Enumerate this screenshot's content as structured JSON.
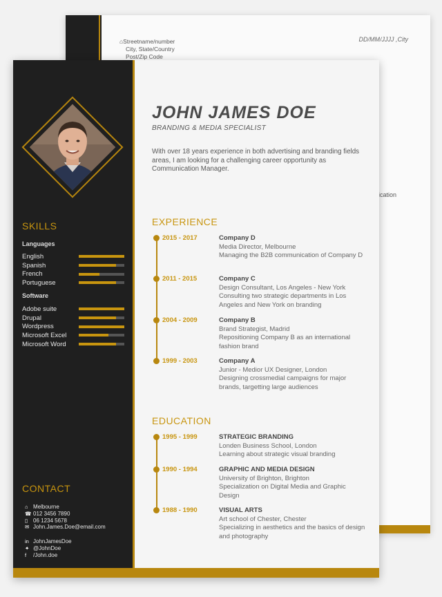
{
  "back_page": {
    "address": [
      "Streetname/number",
      "City, State/Country",
      "Post/Zip Code"
    ],
    "date_city": "DD/MM/JJJJ ,City",
    "fragment": "plication"
  },
  "header": {
    "name": "JOHN JAMES DOE",
    "role": "BRANDING & MEDIA SPECIALIST",
    "summary": "With over 18 years experience in both advertising and branding fields areas, I am looking for a challenging career opportunity as Communication Manager."
  },
  "skills": {
    "title": "SKILLS",
    "languages_label": "Languages",
    "languages": [
      {
        "name": "English",
        "level": 1.0
      },
      {
        "name": "Spanish",
        "level": 0.82
      },
      {
        "name": "French",
        "level": 0.45
      },
      {
        "name": "Portuguese",
        "level": 0.82
      }
    ],
    "software_label": "Software",
    "software": [
      {
        "name": "Adobe suite",
        "level": 1.0
      },
      {
        "name": "Drupal",
        "level": 0.82
      },
      {
        "name": "Wordpress",
        "level": 1.0
      },
      {
        "name": "Microsoft Excel",
        "level": 0.65
      },
      {
        "name": "Microsoft Word",
        "level": 0.82
      }
    ]
  },
  "contact": {
    "title": "CONTACT",
    "items": [
      {
        "icon": "home-icon",
        "glyph": "⌂",
        "text": "Melbourne"
      },
      {
        "icon": "phone-icon",
        "glyph": "☎",
        "text": "012 3456 7890"
      },
      {
        "icon": "mobile-icon",
        "glyph": "▯",
        "text": "06 1234 5678"
      },
      {
        "icon": "email-icon",
        "glyph": "✉",
        "text": "John.James.Doe@email.com"
      }
    ],
    "social": [
      {
        "icon": "linkedin-icon",
        "glyph": "in",
        "text": "JohnJamesDoe"
      },
      {
        "icon": "twitter-icon",
        "glyph": "✦",
        "text": "@JohnDoe"
      },
      {
        "icon": "facebook-icon",
        "glyph": "f",
        "text": "/John.doe"
      }
    ]
  },
  "experience": {
    "title": "EXPERIENCE",
    "entries": [
      {
        "years": "2015 - 2017",
        "company": "Company D",
        "lines": [
          "Media Director, Melbourne",
          "Managing the B2B communication of Company D"
        ]
      },
      {
        "years": "2011 - 2015",
        "company": "Company C",
        "lines": [
          "Design Consultant, Los Angeles - New York",
          "Consulting two strategic departments in Los Angeles and New York on branding"
        ]
      },
      {
        "years": "2004 - 2009",
        "company": "Company B",
        "lines": [
          "Brand Strategist, Madrid",
          "Repositioning Company B as an international fashion brand"
        ]
      },
      {
        "years": "1999 - 2003",
        "company": "Company A",
        "lines": [
          "Junior - Medior  UX Designer, London",
          "Designing crossmedial campaigns for major brands, targetting large audiences"
        ]
      }
    ]
  },
  "education": {
    "title": "EDUCATION",
    "entries": [
      {
        "years": "1995 - 1999",
        "company": "STRATEGIC BRANDING",
        "lines": [
          "Londen Business School, London",
          "Learning about strategic visual branding"
        ]
      },
      {
        "years": "1990 - 1994",
        "company": "GRAPHIC AND MEDIA DESIGN",
        "lines": [
          "University of Brighton, Brighton",
          "Specialization on Digital Media and Graphic Design"
        ]
      },
      {
        "years": "1988 - 1990",
        "company": "VISUAL ARTS",
        "lines": [
          "Art school of Chester, Chester",
          "Specializing in aesthetics and the basics of design and photography"
        ]
      }
    ]
  },
  "colors": {
    "accent": "#b8870e",
    "sidebar": "#1f1f1f",
    "page": "#f5f5f5"
  }
}
